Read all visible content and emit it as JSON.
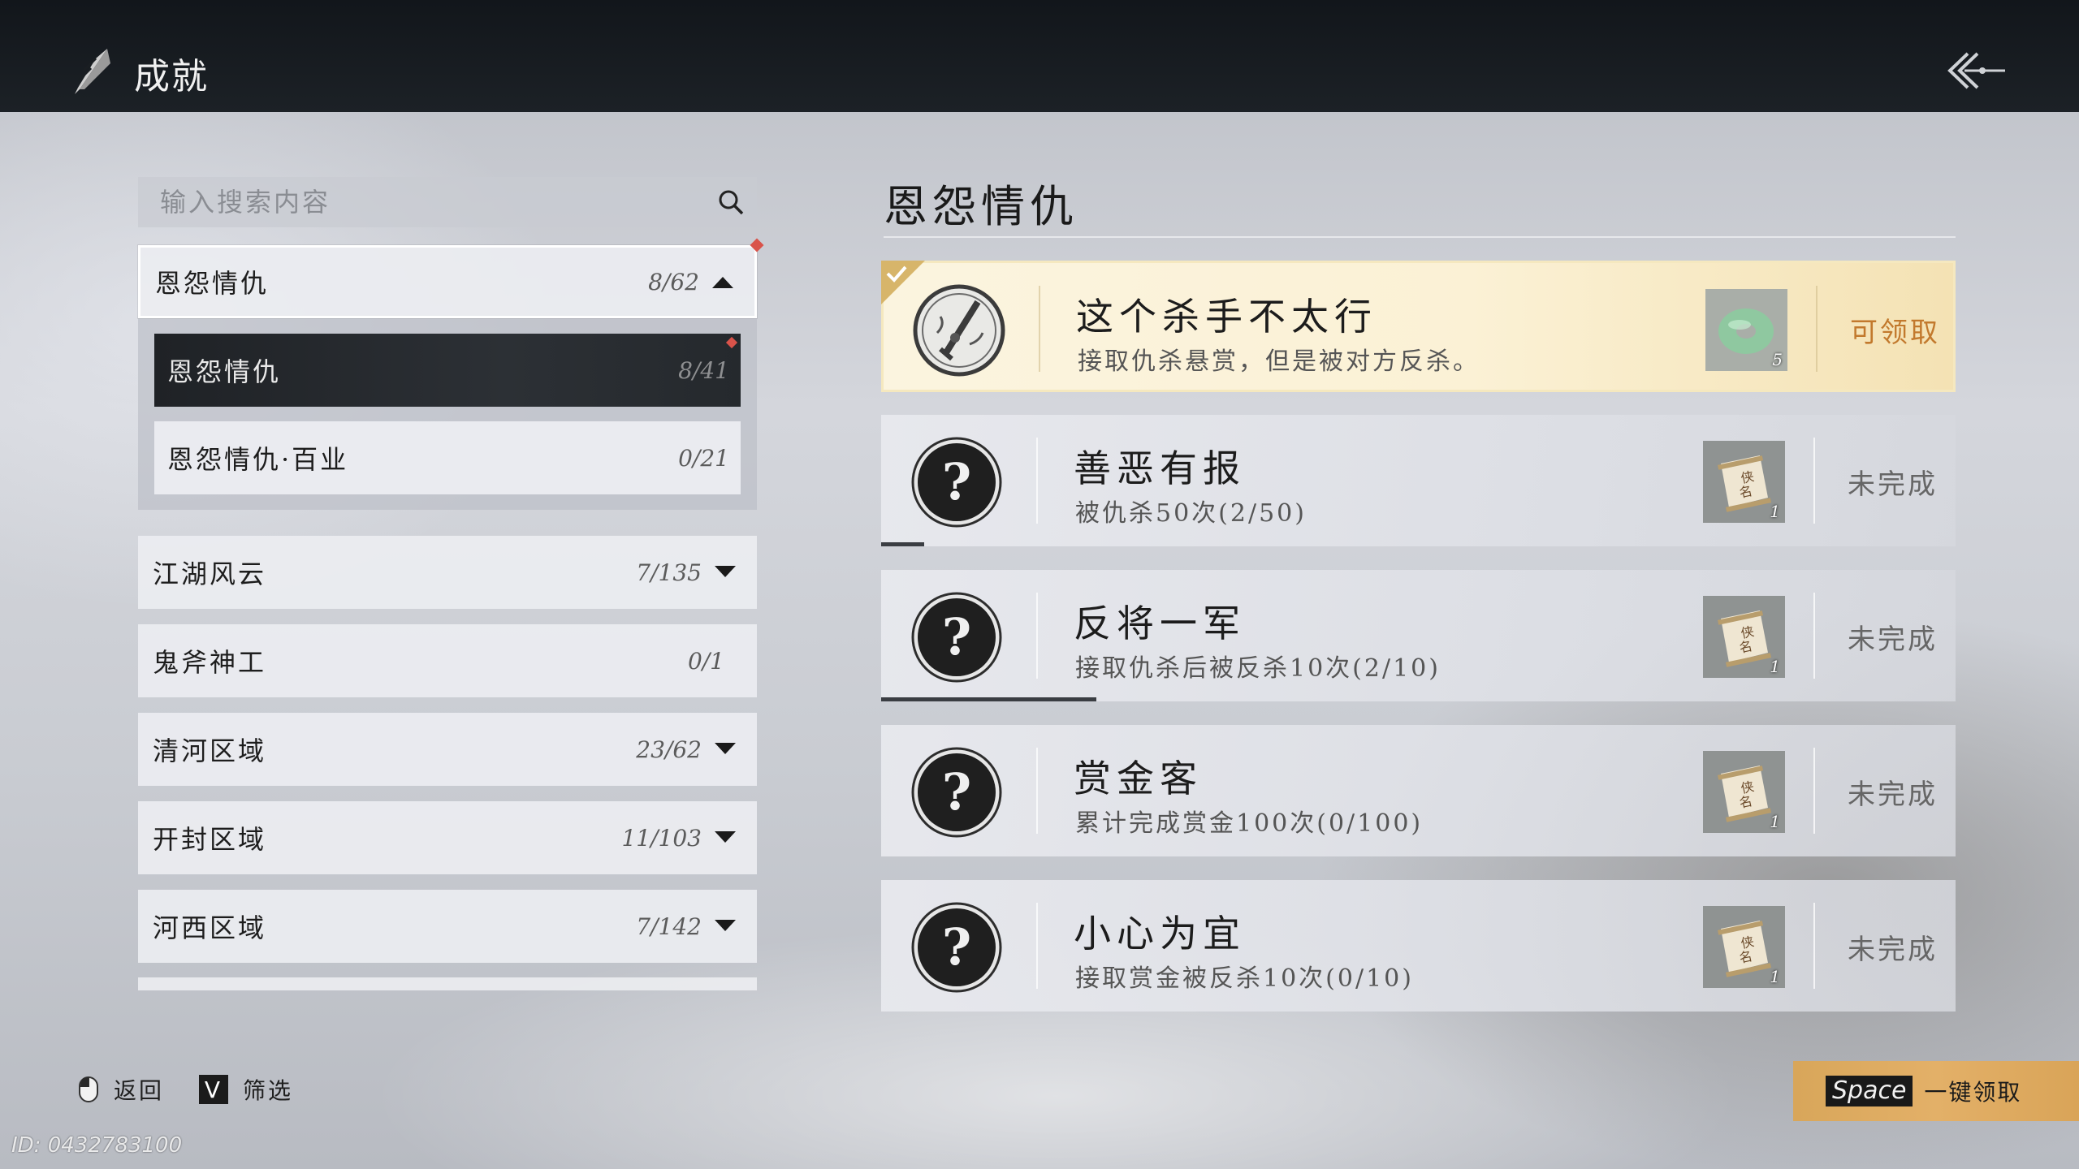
{
  "header": {
    "title": "成就",
    "title_icon": "achievement-quill-icon",
    "back_icon": "back-arrow-icon"
  },
  "search": {
    "placeholder": "输入搜索内容",
    "icon": "search-icon"
  },
  "categories": [
    {
      "name": "恩怨情仇",
      "count": "8/62",
      "expanded": true,
      "has_new": true,
      "children": [
        {
          "name": "恩怨情仇",
          "count": "8/41",
          "selected": true,
          "has_new": true
        },
        {
          "name": "恩怨情仇·百业",
          "count": "0/21",
          "selected": false
        }
      ]
    },
    {
      "name": "江湖风云",
      "count": "7/135",
      "expanded": false
    },
    {
      "name": "鬼斧神工",
      "count": "0/1",
      "expanded": false
    },
    {
      "name": "清河区域",
      "count": "23/62",
      "expanded": false
    },
    {
      "name": "开封区域",
      "count": "11/103",
      "expanded": false
    },
    {
      "name": "河西区域",
      "count": "7/142",
      "expanded": false
    }
  ],
  "section": {
    "title": "恩怨情仇"
  },
  "achievements": [
    {
      "title": "这个杀手不太行",
      "desc": "接取仇杀悬赏，但是被对方反杀。",
      "status": "可领取",
      "claimable": true,
      "badge_icon": "sword-emblem-icon",
      "reward_icon": "jade-pendant-icon",
      "reward_qty": "5"
    },
    {
      "title": "善恶有报",
      "desc": "被仇杀50次(2/50)",
      "status": "未完成",
      "claimable": false,
      "badge_icon": "question-mark-icon",
      "reward_icon": "scroll-icon",
      "reward_qty": "1",
      "progress": 0.04
    },
    {
      "title": "反将一军",
      "desc": "接取仇杀后被反杀10次(2/10)",
      "status": "未完成",
      "claimable": false,
      "badge_icon": "question-mark-icon",
      "reward_icon": "scroll-icon",
      "reward_qty": "1",
      "progress": 0.2
    },
    {
      "title": "赏金客",
      "desc": "累计完成赏金100次(0/100)",
      "status": "未完成",
      "claimable": false,
      "badge_icon": "question-mark-icon",
      "reward_icon": "scroll-icon",
      "reward_qty": "1",
      "progress": 0
    },
    {
      "title": "小心为宜",
      "desc": "接取赏金被反杀10次(0/10)",
      "status": "未完成",
      "claimable": false,
      "badge_icon": "question-mark-icon",
      "reward_icon": "scroll-icon",
      "reward_qty": "1",
      "progress": 0
    }
  ],
  "footer": {
    "back_label": "返回",
    "back_icon": "mouse-icon",
    "filter_key": "V",
    "filter_label": "筛选",
    "claim_all_key": "Space",
    "claim_all_label": "一键领取",
    "uid": "ID: 0432783100"
  },
  "colors": {
    "claim_text": "#c2792d",
    "new_dot": "#d9534a",
    "claim_all_bg": "#e3b068"
  }
}
